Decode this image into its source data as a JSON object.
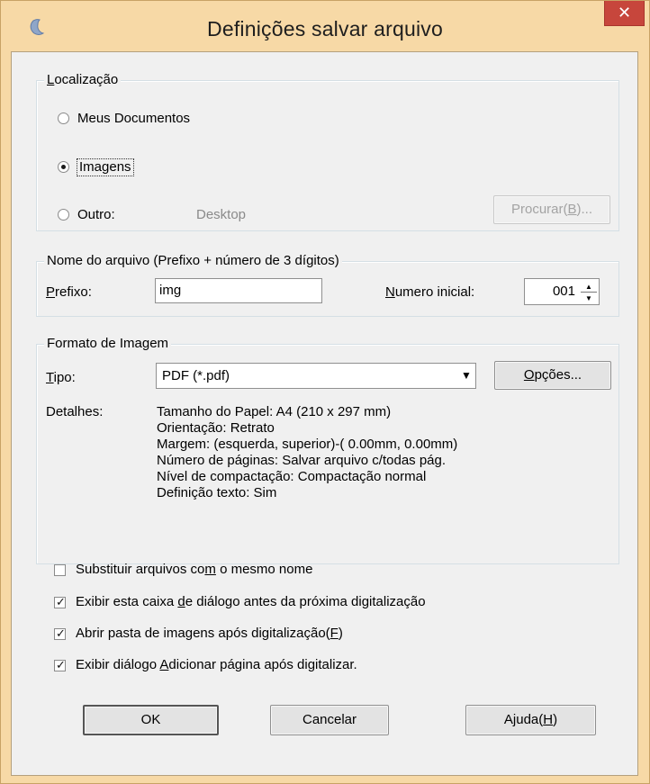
{
  "dialog": {
    "title": "Definições salvar arquivo",
    "close_glyph": "✕",
    "accent_color": "#f7d9a6",
    "close_color": "#c7463c"
  },
  "location": {
    "legend_u": "L",
    "legend_rest": "ocalização",
    "options": [
      {
        "label": "Meus Documentos",
        "checked": false
      },
      {
        "label": "Imagens",
        "checked": true
      },
      {
        "label": "Outro:",
        "checked": false
      }
    ],
    "other_path": "Desktop",
    "browse_label": "Procurar(",
    "browse_key": "B",
    "browse_tail": ")..."
  },
  "filename": {
    "legend": "Nome do arquivo (Prefixo + número de 3 dígitos)",
    "prefix_u": "P",
    "prefix_rest": "refixo:",
    "prefix_value": "img",
    "start_u": "N",
    "start_rest": "umero inicial:",
    "start_value": "001"
  },
  "format": {
    "legend": "Formato de Imagem",
    "type_u": "T",
    "type_rest": "ipo:",
    "type_value": "PDF (*.pdf)",
    "options_u": "O",
    "options_rest": "pções...",
    "details_label": "Detalhes:",
    "details": [
      "Tamanho do Papel: A4 (210 x 297 mm)",
      "Orientação: Retrato",
      "Margem: (esquerda, superior)-( 0.00mm, 0.00mm)",
      "Número de páginas: Salvar arquivo c/todas pág.",
      "Nível de compactação: Compactação normal",
      "Definição texto: Sim"
    ]
  },
  "checks": [
    {
      "pre": "Substituir arquivos co",
      "u": "m",
      "post": " o mesmo nome",
      "checked": false
    },
    {
      "pre": "Exibir esta caixa ",
      "u": "d",
      "post": "e diálogo antes da próxima digitalização",
      "checked": true
    },
    {
      "pre": "Abrir pasta de imagens após digitalização(",
      "u": "F",
      "post": ")",
      "checked": true
    },
    {
      "pre": "Exibir diálogo ",
      "u": "A",
      "post": "dicionar página após digitalizar.",
      "checked": true
    }
  ],
  "buttons": {
    "ok": "OK",
    "cancel": "Cancelar",
    "help_pre": "Ajuda(",
    "help_u": "H",
    "help_post": ")"
  }
}
